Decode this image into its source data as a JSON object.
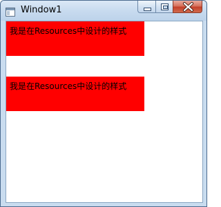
{
  "window": {
    "title": "Window1",
    "icon": "window-app-icon",
    "controls": {
      "minimize_icon": "minimize-icon",
      "maximize_icon": "maximize-icon",
      "close_icon": "close-icon"
    }
  },
  "content": {
    "blocks": [
      {
        "text": "我是在Resources中设计的样式",
        "background": "#ff0000"
      },
      {
        "text": "我是在Resources中设计的样式",
        "background": "#ff0000"
      }
    ]
  },
  "colors": {
    "block_background": "#ff0000",
    "client_background": "#ffffff",
    "close_button": "#c4402a"
  }
}
